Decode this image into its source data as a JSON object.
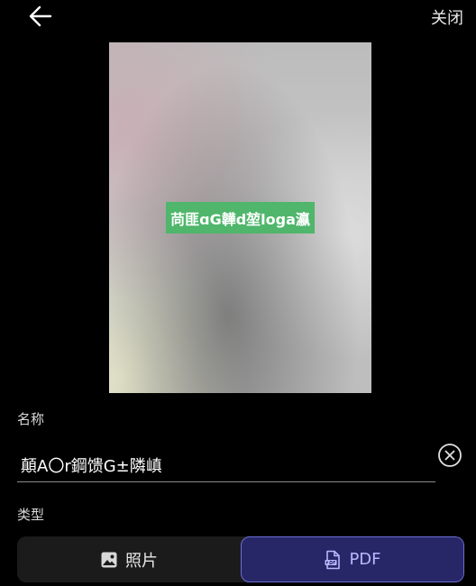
{
  "header": {
    "back_icon": "arrow-left-icon",
    "close_label": "关闭"
  },
  "preview": {
    "overlay_label": "苘匪ɑG韡d堃loga瀛"
  },
  "name_section": {
    "label": "名称",
    "value": "顛A〇r鋼馈G±隣嵮",
    "clear_icon": "close-circle-icon"
  },
  "type_section": {
    "label": "类型",
    "options": [
      {
        "label": "照片",
        "icon": "image-icon",
        "selected": false
      },
      {
        "label": "PDF",
        "icon": "pdf-file-icon",
        "selected": true
      }
    ]
  },
  "colors": {
    "background": "#000000",
    "badge": "#4fb66b",
    "selected_bg": "#272768",
    "selected_text": "#b7b8ff"
  }
}
